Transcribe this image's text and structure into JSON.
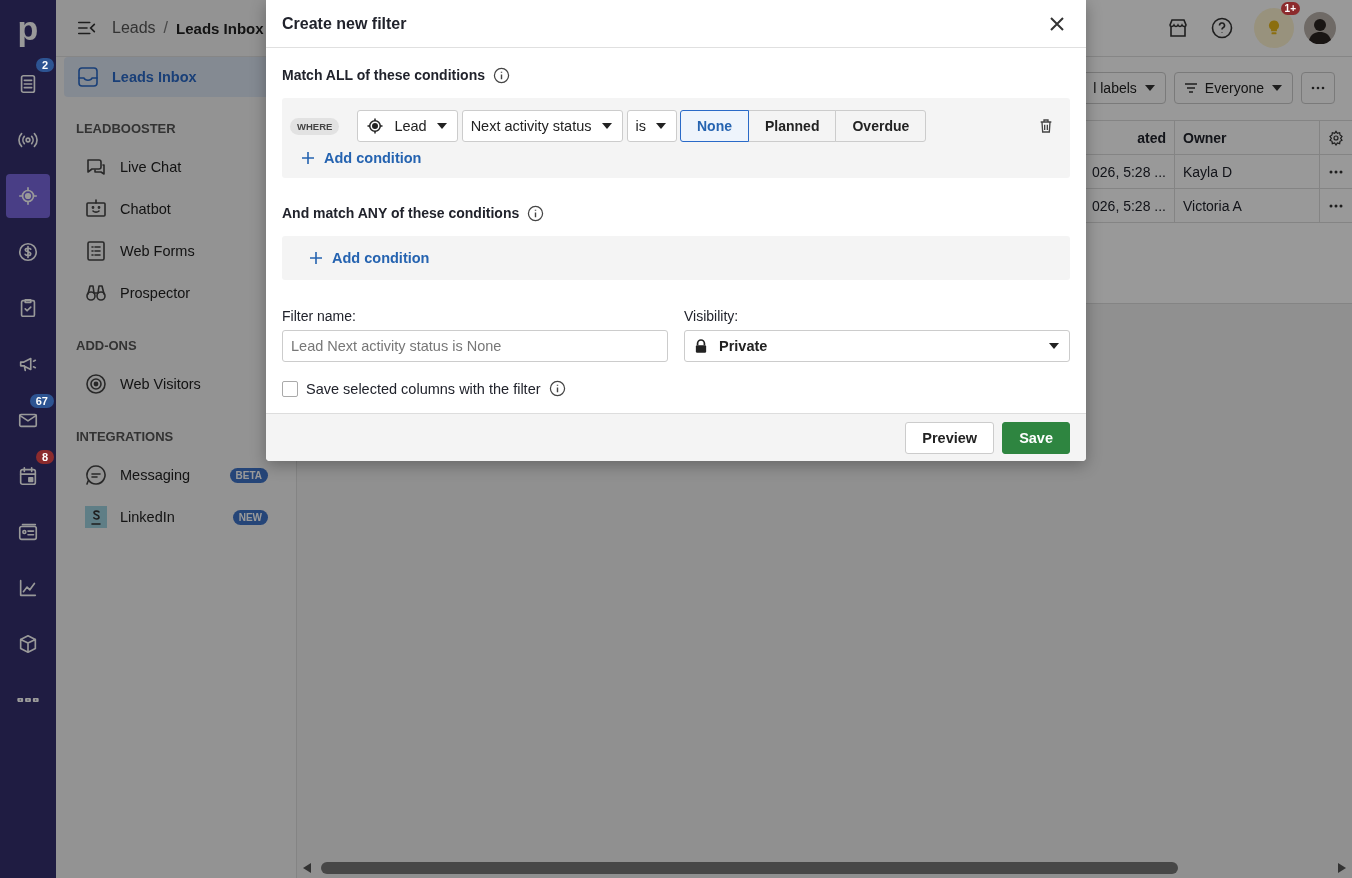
{
  "rail": {
    "logo": "p",
    "items": [
      {
        "selected": false,
        "badge": {
          "text": "2",
          "color": "#2d5492"
        }
      },
      {
        "selected": false
      },
      {
        "selected": true
      },
      {
        "selected": false
      },
      {
        "selected": false
      },
      {
        "selected": false
      },
      {
        "selected": false,
        "badge": {
          "text": "67",
          "color": "#2d5492"
        }
      },
      {
        "selected": false,
        "badge": {
          "text": "8",
          "color": "#8c2b2d"
        }
      },
      {
        "selected": false
      },
      {
        "selected": false
      },
      {
        "selected": false
      },
      {
        "selected": false
      }
    ]
  },
  "sidebar": {
    "sections": [
      {
        "items": [
          {
            "label": "Leads Inbox",
            "selected": true
          }
        ]
      },
      {
        "heading": "LEADBOOSTER",
        "items": [
          {
            "label": "Live Chat",
            "selected": false
          },
          {
            "label": "Chatbot",
            "selected": false
          },
          {
            "label": "Web Forms",
            "selected": false
          },
          {
            "label": "Prospector",
            "selected": false
          }
        ]
      },
      {
        "heading": "ADD-ONS",
        "items": [
          {
            "label": "Web Visitors",
            "selected": false
          }
        ]
      },
      {
        "heading": "INTEGRATIONS",
        "items": [
          {
            "label": "Messaging",
            "selected": false,
            "tag": "BETA"
          },
          {
            "label": "LinkedIn",
            "selected": false,
            "tag": "NEW"
          }
        ]
      }
    ]
  },
  "topbar": {
    "breadcrumb": {
      "parent": "Leads",
      "separator": "/",
      "current": "Leads Inbox"
    },
    "notification_badge": "1+"
  },
  "toolbar": {
    "buttons": [
      "l labels",
      "Everyone"
    ]
  },
  "table": {
    "columns": [
      "ated",
      "Owner"
    ],
    "rows": [
      [
        "026, 5:28 ...",
        "Kayla D"
      ],
      [
        "026, 5:28 ...",
        "Victoria A"
      ]
    ]
  },
  "dialog": {
    "title": "Create new filter",
    "all_section": {
      "title": "Match ALL of these conditions",
      "conditions": [
        {
          "where": "WHERE",
          "object": "Lead",
          "field": "Next activity status",
          "operator": "is",
          "options": [
            {
              "label": "None",
              "selected": true
            },
            {
              "label": "Planned",
              "selected": false
            },
            {
              "label": "Overdue",
              "selected": false
            }
          ]
        }
      ],
      "add": "Add condition"
    },
    "any_section": {
      "title": "And match ANY of these conditions",
      "add": "Add condition"
    },
    "filter_name": {
      "label": "Filter name:",
      "placeholder": "Lead Next activity status is None"
    },
    "visibility": {
      "label": "Visibility:",
      "value": "Private"
    },
    "save_columns": {
      "label": "Save selected columns with the filter",
      "checked": false
    },
    "buttons": {
      "preview": "Preview",
      "save": "Save"
    }
  }
}
